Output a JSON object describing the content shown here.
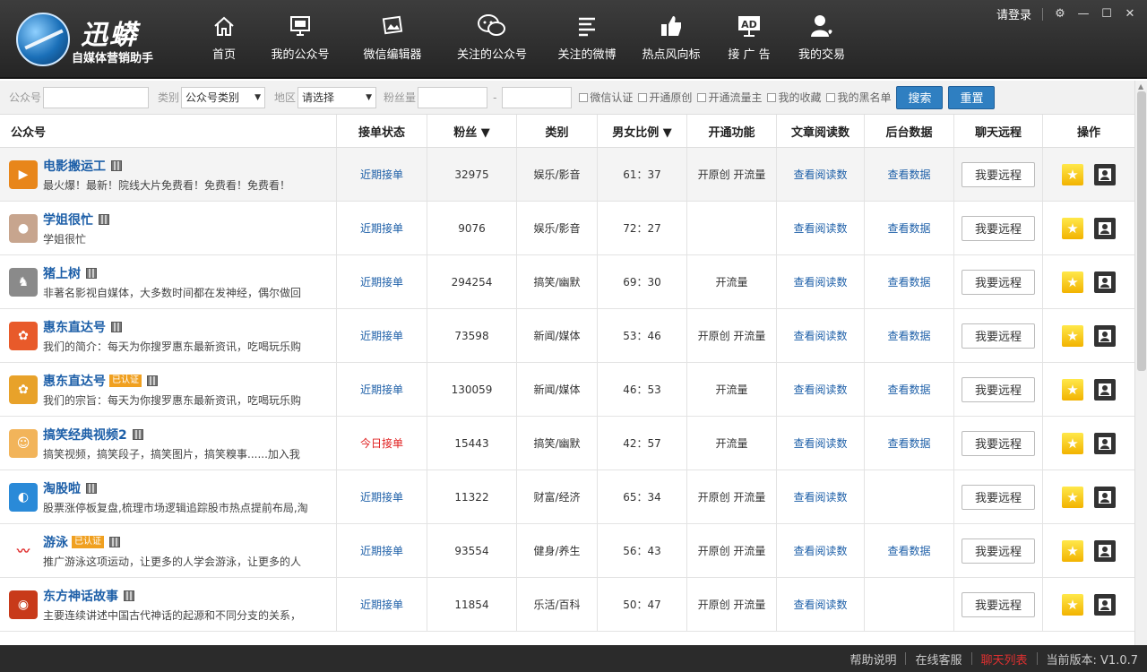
{
  "app": {
    "logo_title": "迅蟒",
    "logo_subtitle": "自媒体营销助手"
  },
  "nav": [
    {
      "icon": "home-icon",
      "label": "首页"
    },
    {
      "icon": "monitor-icon",
      "label": "我的公众号"
    },
    {
      "icon": "image-edit-icon",
      "label": "微信编辑器"
    },
    {
      "icon": "wechat-icon",
      "label": "关注的公众号"
    },
    {
      "icon": "list-icon",
      "label": "关注的微博"
    },
    {
      "icon": "thumbs-up-icon",
      "label": "热点风向标"
    },
    {
      "icon": "ad-icon",
      "label": "接 广 告"
    },
    {
      "icon": "user-heart-icon",
      "label": "我的交易"
    }
  ],
  "window": {
    "login": "请登录",
    "settings_icon": "⚙",
    "minimize": "—",
    "maximize": "☐",
    "close": "✕"
  },
  "filter": {
    "account_label": "公众号",
    "account_value": "",
    "category_label": "类别",
    "category_value": "公众号类别",
    "region_label": "地区",
    "region_value": "请选择",
    "fans_label": "粉丝量",
    "fans_sep": "-",
    "fans_min": "",
    "fans_max": "",
    "checks": [
      "微信认证",
      "开通原创",
      "开通流量主",
      "我的收藏",
      "我的黑名单"
    ],
    "search": "搜索",
    "reset": "重置"
  },
  "table": {
    "headers": [
      "公众号",
      "接单状态",
      "粉丝 ▼",
      "类别",
      "男女比例 ▼",
      "开通功能",
      "文章阅读数",
      "后台数据",
      "聊天远程",
      "操作"
    ],
    "rows": [
      {
        "name": "电影搬运工",
        "badge": "",
        "desc": "最火爆！最新！院线大片免费看！免费看！免费看！",
        "status": "近期接单",
        "status_red": false,
        "fans": "32975",
        "category": "娱乐/影音",
        "ratio": "61：37",
        "features": "开原创 开流量",
        "read": "查看阅读数",
        "backend": "查看数据",
        "remote": "我要远程",
        "avatar_color": "#e8861a",
        "avatar_text": "▶"
      },
      {
        "name": "学姐很忙",
        "badge": "",
        "desc": "学姐很忙",
        "status": "近期接单",
        "status_red": false,
        "fans": "9076",
        "category": "娱乐/影音",
        "ratio": "72：27",
        "features": "",
        "read": "查看阅读数",
        "backend": "查看数据",
        "remote": "我要远程",
        "avatar_color": "#c7a58e",
        "avatar_text": "●"
      },
      {
        "name": "猪上树",
        "badge": "",
        "desc": "非著名影视自媒体，大多数时间都在发神经，偶尔做回",
        "status": "近期接单",
        "status_red": false,
        "fans": "294254",
        "category": "搞笑/幽默",
        "ratio": "69：30",
        "features": "开流量",
        "read": "查看阅读数",
        "backend": "查看数据",
        "remote": "我要远程",
        "avatar_color": "#8a8a8a",
        "avatar_text": "♞"
      },
      {
        "name": "惠东直达号",
        "badge": "",
        "desc": "我们的简介：每天为你搜罗惠东最新资讯，吃喝玩乐购",
        "status": "近期接单",
        "status_red": false,
        "fans": "73598",
        "category": "新闻/媒体",
        "ratio": "53：46",
        "features": "开原创 开流量",
        "read": "查看阅读数",
        "backend": "查看数据",
        "remote": "我要远程",
        "avatar_color": "#e85a2a",
        "avatar_text": "✿"
      },
      {
        "name": "惠东直达号",
        "badge": "已认证",
        "desc": "我们的宗旨：每天为你搜罗惠东最新资讯，吃喝玩乐购",
        "status": "近期接单",
        "status_red": false,
        "fans": "130059",
        "category": "新闻/媒体",
        "ratio": "46：53",
        "features": "开流量",
        "read": "查看阅读数",
        "backend": "查看数据",
        "remote": "我要远程",
        "avatar_color": "#e8a22a",
        "avatar_text": "✿"
      },
      {
        "name": "搞笑经典视频2",
        "badge": "",
        "desc": "搞笑视频，搞笑段子，搞笑图片，搞笑糗事......加入我",
        "status": "今日接单",
        "status_red": true,
        "fans": "15443",
        "category": "搞笑/幽默",
        "ratio": "42：57",
        "features": "开流量",
        "read": "查看阅读数",
        "backend": "查看数据",
        "remote": "我要远程",
        "avatar_color": "#f2b45a",
        "avatar_text": "☺"
      },
      {
        "name": "淘股啦",
        "badge": "",
        "desc": "股票涨停板复盘,梳理市场逻辑追踪股市热点提前布局,淘",
        "status": "近期接单",
        "status_red": false,
        "fans": "11322",
        "category": "财富/经济",
        "ratio": "65：34",
        "features": "开原创 开流量",
        "read": "查看阅读数",
        "backend": "",
        "remote": "我要远程",
        "avatar_color": "#2a8ad8",
        "avatar_text": "◐"
      },
      {
        "name": "游泳",
        "badge": "已认证",
        "desc": "推广游泳这项运动，让更多的人学会游泳，让更多的人",
        "status": "近期接单",
        "status_red": false,
        "fans": "93554",
        "category": "健身/养生",
        "ratio": "56：43",
        "features": "开原创 开流量",
        "read": "查看阅读数",
        "backend": "查看数据",
        "remote": "我要远程",
        "avatar_color": "#ffffff",
        "avatar_text": "〰"
      },
      {
        "name": "东方神话故事",
        "badge": "",
        "desc": "主要连续讲述中国古代神话的起源和不同分支的关系，",
        "status": "近期接单",
        "status_red": false,
        "fans": "11854",
        "category": "乐活/百科",
        "ratio": "50：47",
        "features": "开原创 开流量",
        "read": "查看阅读数",
        "backend": "",
        "remote": "我要远程",
        "avatar_color": "#c83a1a",
        "avatar_text": "◉"
      }
    ]
  },
  "footer": {
    "help": "帮助说明",
    "service": "在线客服",
    "chat_list": "聊天列表",
    "version_label": "当前版本: V1.0.7"
  }
}
